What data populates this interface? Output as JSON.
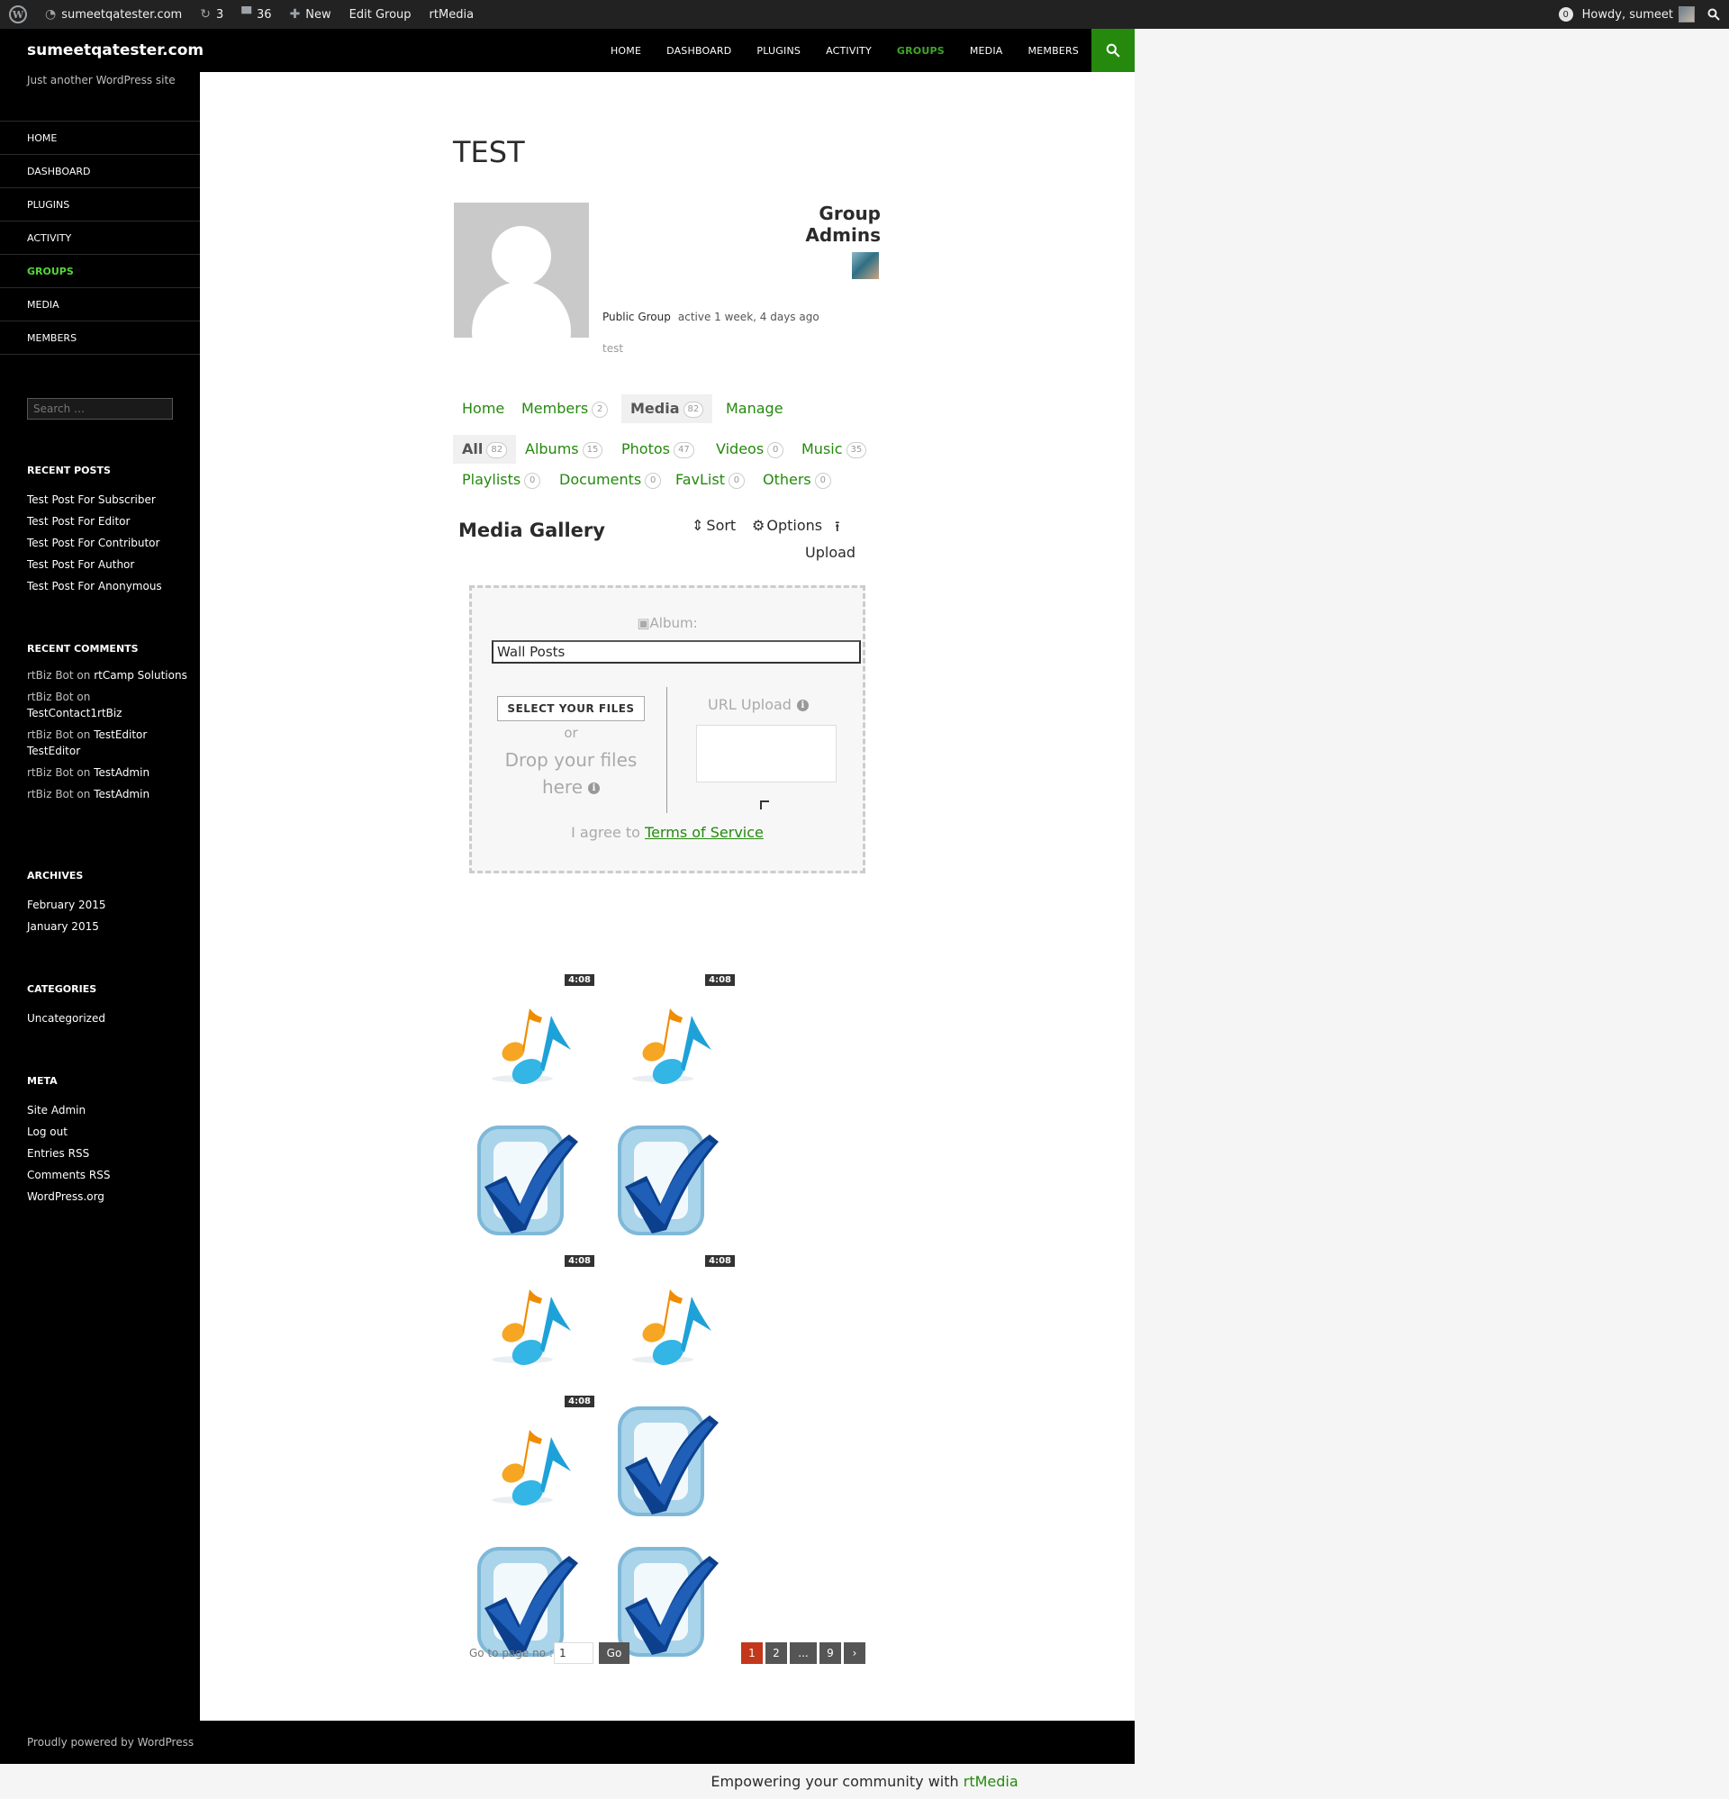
{
  "admin_bar": {
    "site_name": "sumeetqatester.com",
    "updates_count": "3",
    "comments_count": "36",
    "new_label": "New",
    "edit_group_label": "Edit Group",
    "rtmedia_label": "rtMedia",
    "notifications_count": "0",
    "howdy": "Howdy, sumeet"
  },
  "header": {
    "site_title": "sumeetqatester.com",
    "nav": [
      "HOME",
      "DASHBOARD",
      "PLUGINS",
      "ACTIVITY",
      "GROUPS",
      "MEDIA",
      "MEMBERS"
    ],
    "active_nav": "GROUPS"
  },
  "sidebar": {
    "description": "Just another WordPress site",
    "nav": [
      "HOME",
      "DASHBOARD",
      "PLUGINS",
      "ACTIVITY",
      "GROUPS",
      "MEDIA",
      "MEMBERS"
    ],
    "search_placeholder": "Search …",
    "recent_posts": {
      "title": "RECENT POSTS",
      "items": [
        "Test Post For Subscriber",
        "Test Post For Editor",
        "Test Post For Contributor",
        "Test Post For Author",
        "Test Post For Anonymous"
      ]
    },
    "recent_comments": {
      "title": "RECENT COMMENTS",
      "items": [
        {
          "author": "rtBiz Bot",
          "sep": " on ",
          "post": "rtCamp Solutions"
        },
        {
          "author": "rtBiz Bot",
          "sep": " on ",
          "post": "TestContact1rtBiz"
        },
        {
          "author": "rtBiz Bot",
          "sep": " on ",
          "post": "TestEditor TestEditor"
        },
        {
          "author": "rtBiz Bot",
          "sep": " on ",
          "post": "TestAdmin"
        },
        {
          "author": "rtBiz Bot",
          "sep": " on ",
          "post": "TestAdmin"
        }
      ]
    },
    "archives": {
      "title": "ARCHIVES",
      "items": [
        "February 2015",
        "January 2015"
      ]
    },
    "categories": {
      "title": "CATEGORIES",
      "items": [
        "Uncategorized"
      ]
    },
    "meta": {
      "title": "META",
      "items": [
        "Site Admin",
        "Log out",
        "Entries RSS",
        "Comments RSS",
        "WordPress.org"
      ]
    }
  },
  "group": {
    "title": "TEST",
    "admins_title": "Group Admins",
    "type": "Public Group",
    "active": "active 1 week, 4 days ago",
    "description": "test"
  },
  "tabs": {
    "home": "Home",
    "members": "Members",
    "members_count": "2",
    "media": "Media",
    "media_count": "82",
    "manage": "Manage"
  },
  "media_tabs": {
    "all": "All",
    "all_count": "82",
    "albums": "Albums",
    "albums_count": "15",
    "photos": "Photos",
    "photos_count": "47",
    "videos": "Videos",
    "videos_count": "0",
    "music": "Music",
    "music_count": "35",
    "playlists": "Playlists",
    "playlists_count": "0",
    "documents": "Documents",
    "documents_count": "0",
    "favlist": "FavList",
    "favlist_count": "0",
    "others": "Others",
    "others_count": "0"
  },
  "gallery": {
    "title": "Media Gallery",
    "sort": "Sort",
    "options": "Options",
    "upload": "Upload"
  },
  "uploader": {
    "album_label": "Album:",
    "album_value": "Wall Posts",
    "select_files": "SELECT YOUR FILES",
    "or": "or",
    "drop": "Drop your files here",
    "url_upload": "URL Upload",
    "tos_prefix": "I agree to ",
    "tos_link": "Terms of Service"
  },
  "media_items": [
    {
      "type": "music",
      "duration": "4:08"
    },
    {
      "type": "music",
      "duration": "4:08"
    },
    {
      "type": "photo"
    },
    {
      "type": "photo"
    },
    {
      "type": "music",
      "duration": "4:08"
    },
    {
      "type": "music",
      "duration": "4:08"
    },
    {
      "type": "music",
      "duration": "4:08"
    },
    {
      "type": "photo"
    },
    {
      "type": "photo"
    },
    {
      "type": "photo"
    }
  ],
  "pagination": {
    "goto_label": "Go to page no :",
    "goto_value": "1",
    "go": "Go",
    "pages": [
      "1",
      "2",
      "...",
      "9",
      "›"
    ],
    "current": "1"
  },
  "footer": {
    "credit": "Proudly powered by WordPress",
    "rtmedia_prefix": "Empowering your community with ",
    "rtmedia_link": "rtMedia"
  },
  "colors": {
    "accent_green": "#24890d",
    "active_nav_green": "#41a62a",
    "pagination_current": "#c3371a"
  }
}
